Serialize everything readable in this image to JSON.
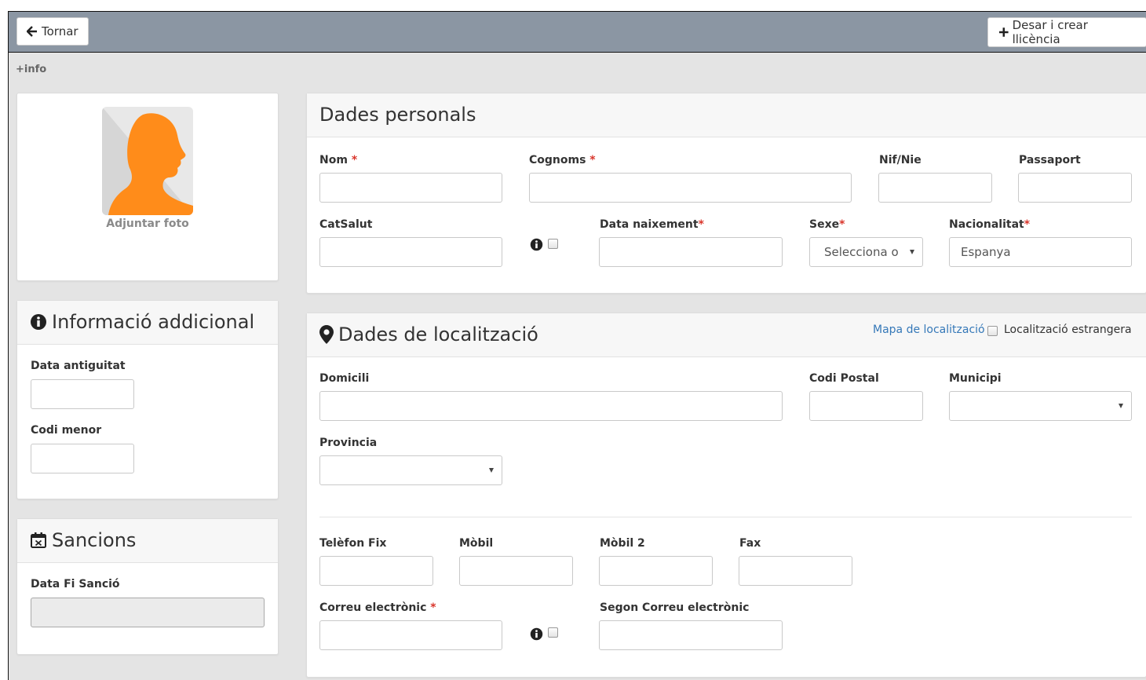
{
  "toolbar": {
    "back_label": "Tornar",
    "save_label": "Desar i crear llicència"
  },
  "info_link": "+info",
  "photo": {
    "attach_label": "Adjuntar foto"
  },
  "additional": {
    "title": "Informació addicional",
    "date_label": "Data antiguitat",
    "code_label": "Codi menor"
  },
  "sanctions": {
    "title": "Sancions",
    "end_date_label": "Data Fi Sanció"
  },
  "personal": {
    "title": "Dades personals",
    "name_label": "Nom",
    "surnames_label": "Cognoms",
    "nif_label": "Nif/Nie",
    "passport_label": "Passaport",
    "catsalut_label": "CatSalut",
    "birth_label": "Data naixement",
    "sex_label": "Sexe",
    "sex_value": "Selecciona o",
    "nationality_label": "Nacionalitat",
    "nationality_value": "Espanya",
    "required_mark": "*"
  },
  "location": {
    "title": "Dades de localització",
    "map_link": "Mapa de localització",
    "foreign_label": "Localització estrangera",
    "address_label": "Domicili",
    "postal_label": "Codi Postal",
    "municipality_label": "Municipi",
    "province_label": "Provincia",
    "phone_label": "Telèfon Fix",
    "mobile_label": "Mòbil",
    "mobile2_label": "Mòbil 2",
    "fax_label": "Fax",
    "email_label": "Correu electrònic",
    "email2_label": "Segon Correu electrònic"
  },
  "colors": {
    "toolbar_bg": "#8b96a3",
    "required": "#d9352b",
    "link": "#3578b8",
    "avatar_orange": "#ff8c1a"
  }
}
